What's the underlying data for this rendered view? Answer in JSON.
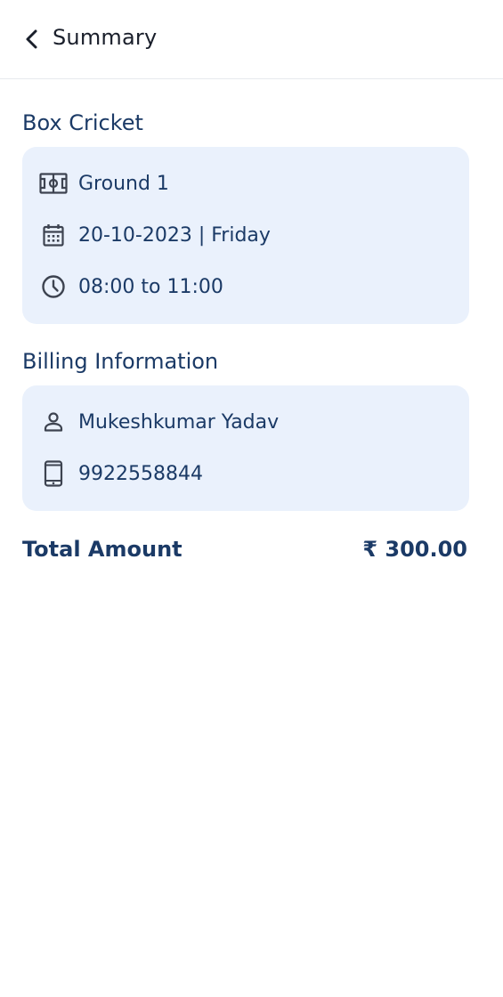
{
  "header": {
    "title": "Summary",
    "back_icon": "chevron-left-icon"
  },
  "booking": {
    "sport": "Box Cricket",
    "ground": "Ground 1",
    "date": "20-10-2023 | Friday",
    "time": "08:00 to 11:00",
    "icons": [
      "football-field-icon",
      "calendar-icon",
      "clock-icon"
    ]
  },
  "billing": {
    "title": "Billing Information",
    "name": "Mukeshkumar Yadav",
    "phone": "9922558844",
    "icons": [
      "person-icon",
      "phone-icon"
    ]
  },
  "total": {
    "label": "Total Amount",
    "value": "₹ 300.00"
  },
  "colors": {
    "primary": "#1b3a66",
    "card_bg": "#eaf1fc",
    "icon": "#3d4350"
  }
}
